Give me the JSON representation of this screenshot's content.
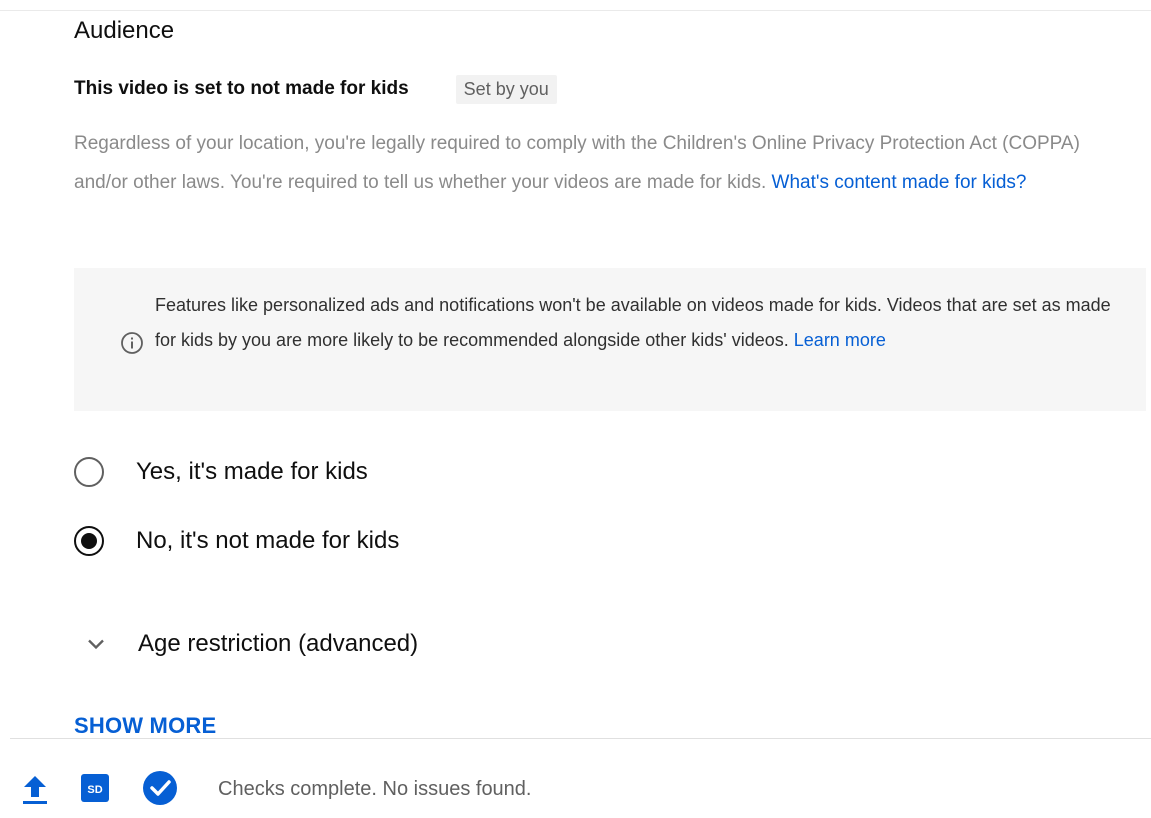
{
  "audience": {
    "title": "Audience",
    "status_text": "This video is set to not made for kids",
    "status_chip": "Set by you",
    "description": "Regardless of your location, you're legally required to comply with the Children's Online Privacy Protection Act (COPPA) and/or other laws. You're required to tell us whether your videos are made for kids.",
    "description_link": "What's content made for kids?",
    "info_text": "Features like personalized ads and notifications won't be available on videos made for kids. Videos that are set as made for kids by you are more likely to be recommended alongside other kids' videos.",
    "info_link": "Learn more",
    "options": [
      {
        "label": "Yes, it's made for kids",
        "selected": false
      },
      {
        "label": "No, it's not made for kids",
        "selected": true
      }
    ],
    "age_restriction_label": "Age restriction (advanced)",
    "show_more_label": "SHOW MORE"
  },
  "footer": {
    "status_text": "Checks complete. No issues found.",
    "sd_badge": "SD",
    "icons": [
      "upload-icon",
      "sd-icon",
      "check-circle-icon"
    ]
  },
  "colors": {
    "link": "#065fd4",
    "muted_text": "#8a8a8a",
    "info_bg": "#f6f6f6"
  }
}
